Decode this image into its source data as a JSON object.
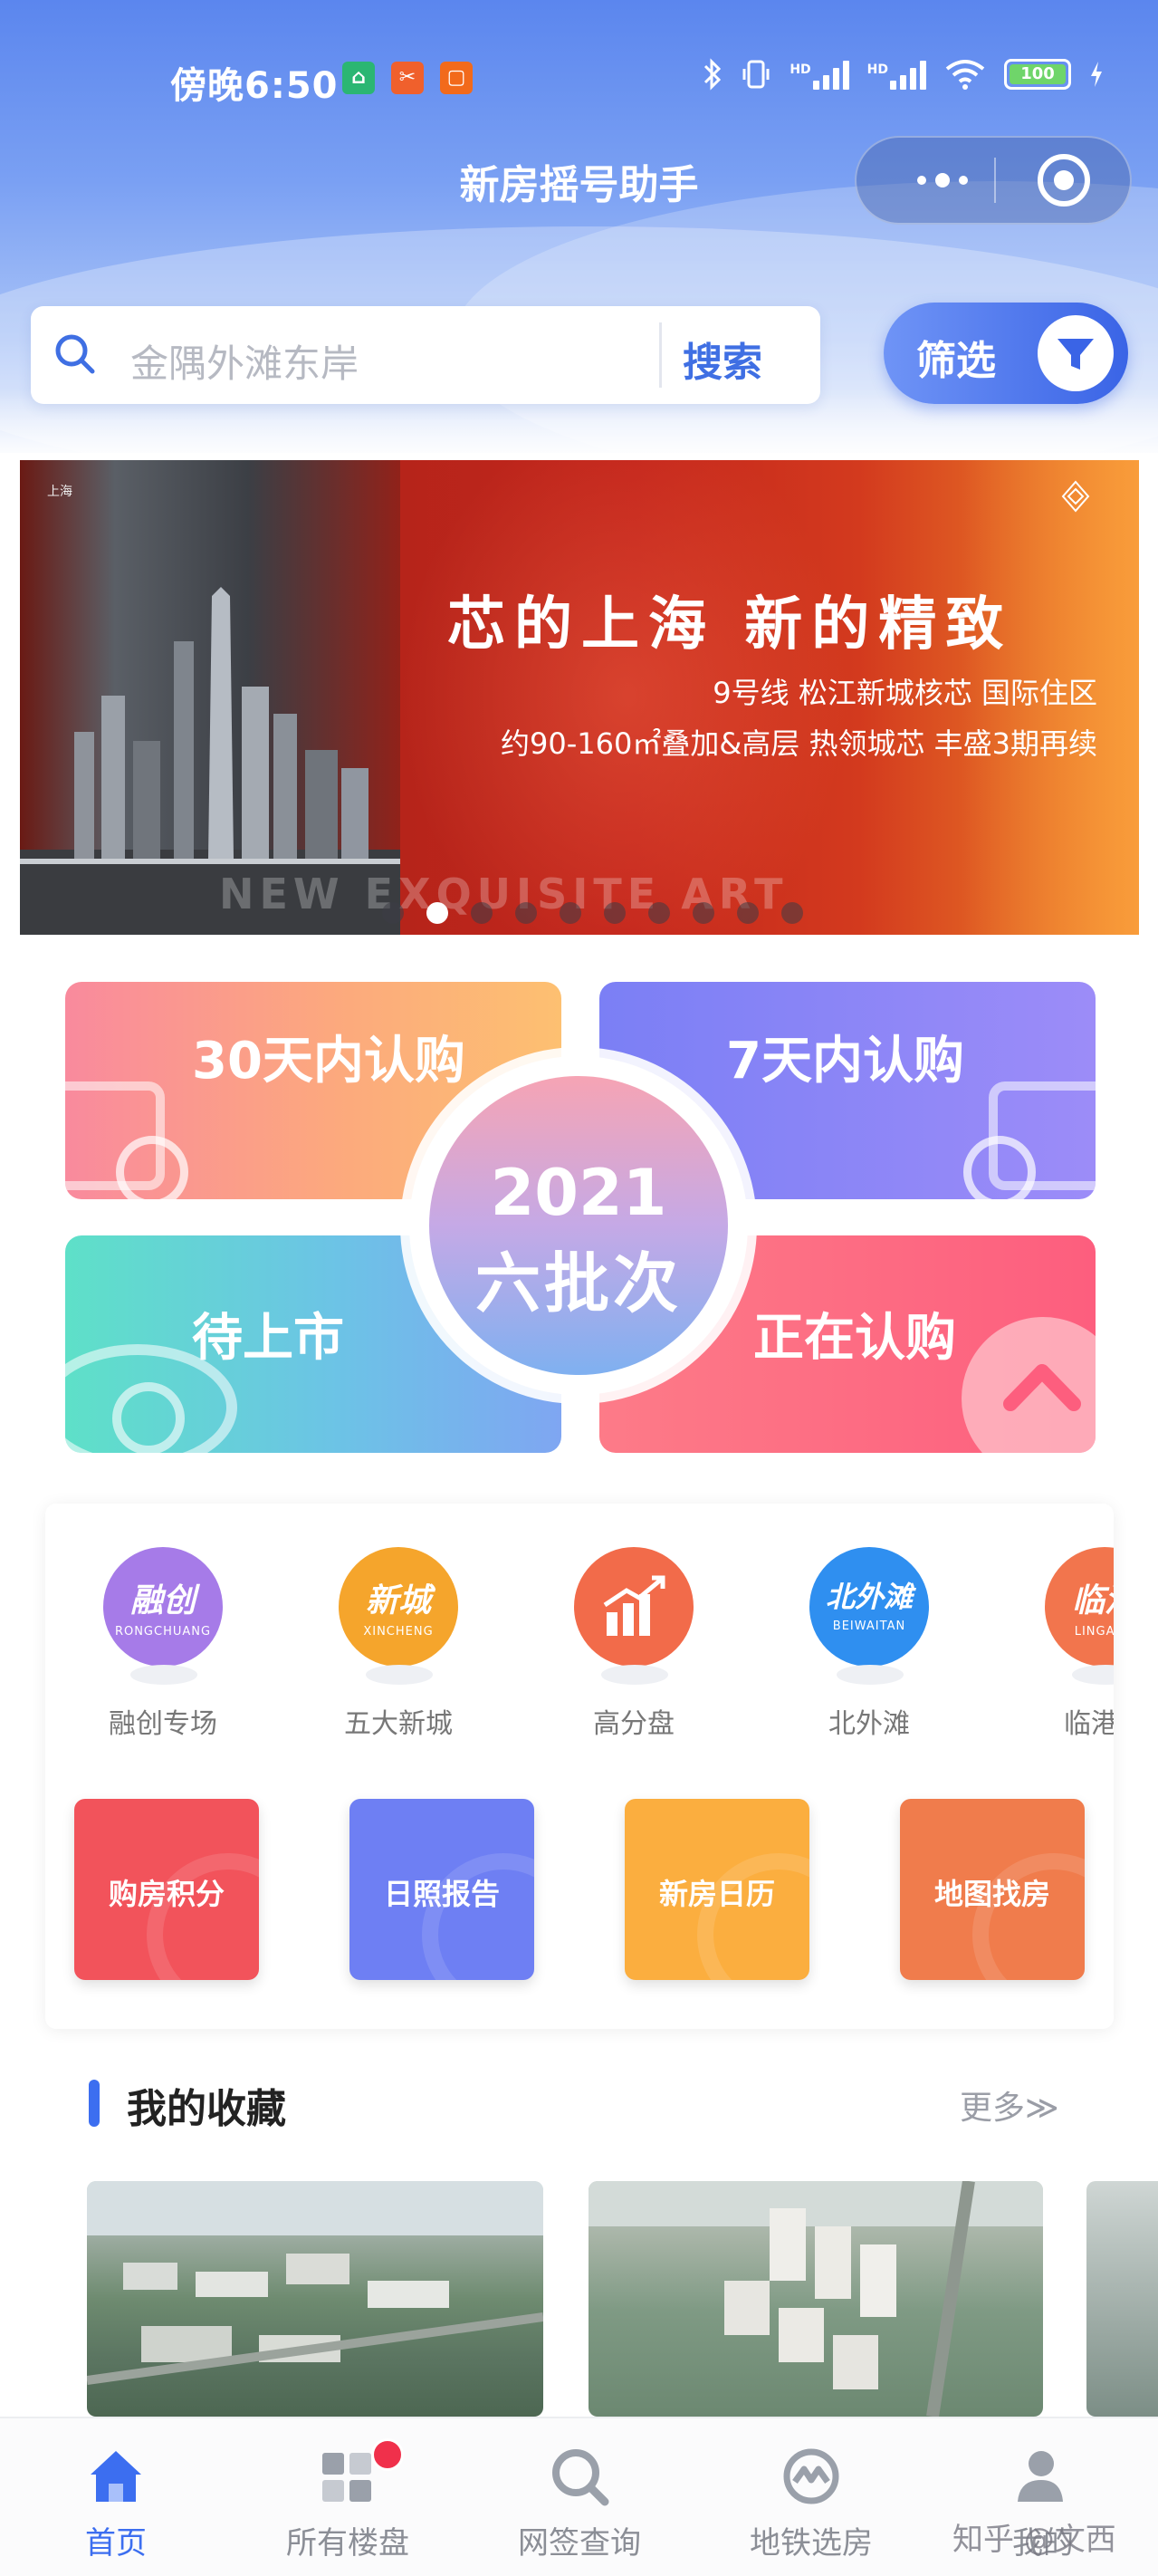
{
  "status_bar": {
    "time": "傍晚6:50",
    "battery": "100",
    "app_icons": [
      "home-app-icon",
      "scissors-app-icon",
      "square-app-icon"
    ]
  },
  "nav": {
    "title": "新房摇号助手"
  },
  "search": {
    "placeholder": "金隅外滩东岸",
    "button": "搜索",
    "filter_label": "筛选"
  },
  "banner": {
    "headline": "芯的上海 新的精致",
    "sub1": "9号线 松江新城核芯 国际住区",
    "sub2": "约90-160㎡叠加&高层 热领城芯 丰盛3期再续",
    "watermark": "NEW EXQUISITE ART",
    "brand": "上海",
    "dots_total": 10,
    "active_dot": 2
  },
  "sales": {
    "q1": "30天内认购",
    "q2": "7天内认购",
    "q3": "待上市",
    "q4": "正在认购",
    "center_year": "2021",
    "center_batch": "六批次"
  },
  "categories": [
    {
      "cn": "融创",
      "en": "RONGCHUANG",
      "label": "融创专场",
      "color": "#a67be8"
    },
    {
      "cn": "新城",
      "en": "XINCHENG",
      "label": "五大新城",
      "color": "#f5a52c"
    },
    {
      "cn": "",
      "en": "",
      "label": "高分盘",
      "color": "#f26b4a"
    },
    {
      "cn": "北外滩",
      "en": "BEIWAITAN",
      "label": "北外滩",
      "color": "#2f8ff0"
    },
    {
      "cn": "临港",
      "en": "LINGANG",
      "label": "临港项",
      "color": "#f2754d"
    }
  ],
  "tools": [
    {
      "label": "购房积分",
      "color": "#f2535b"
    },
    {
      "label": "日照报告",
      "color": "#6e7ff3"
    },
    {
      "label": "新房日历",
      "color": "#fbae3f"
    },
    {
      "label": "地图找房",
      "color": "#f07c4c"
    }
  ],
  "favorites": {
    "title": "我的收藏",
    "more": "更多≫"
  },
  "tabs": [
    {
      "label": "首页",
      "active": true
    },
    {
      "label": "所有楼盘",
      "active": false
    },
    {
      "label": "网签查询",
      "active": false
    },
    {
      "label": "地铁选房",
      "active": false
    },
    {
      "label": "我的",
      "active": false
    }
  ],
  "watermark": "知乎 @文西",
  "colors": {
    "primary": "#3c6ef0",
    "header_top": "#5b86ee",
    "badge_red": "#f0304b"
  }
}
